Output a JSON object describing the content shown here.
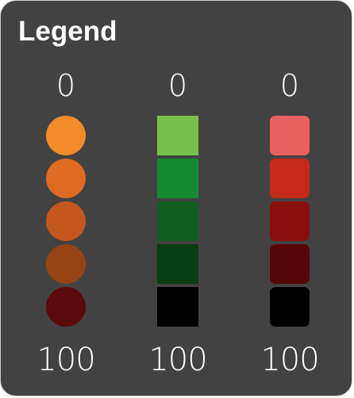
{
  "legend": {
    "title": "Legend",
    "columns": [
      {
        "shape": "circle",
        "min_label": "0",
        "max_label": "100",
        "colors": [
          "#f28c28",
          "#df6a22",
          "#c4571d",
          "#964313",
          "#5b0a0b"
        ]
      },
      {
        "shape": "square",
        "min_label": "0",
        "max_label": "100",
        "colors": [
          "#77c14c",
          "#168a33",
          "#125e20",
          "#0b3d12",
          "#000000"
        ]
      },
      {
        "shape": "rounded-square",
        "min_label": "0",
        "max_label": "100",
        "colors": [
          "#ea6060",
          "#c42a1a",
          "#8a0f0e",
          "#560709",
          "#000000"
        ]
      }
    ]
  }
}
